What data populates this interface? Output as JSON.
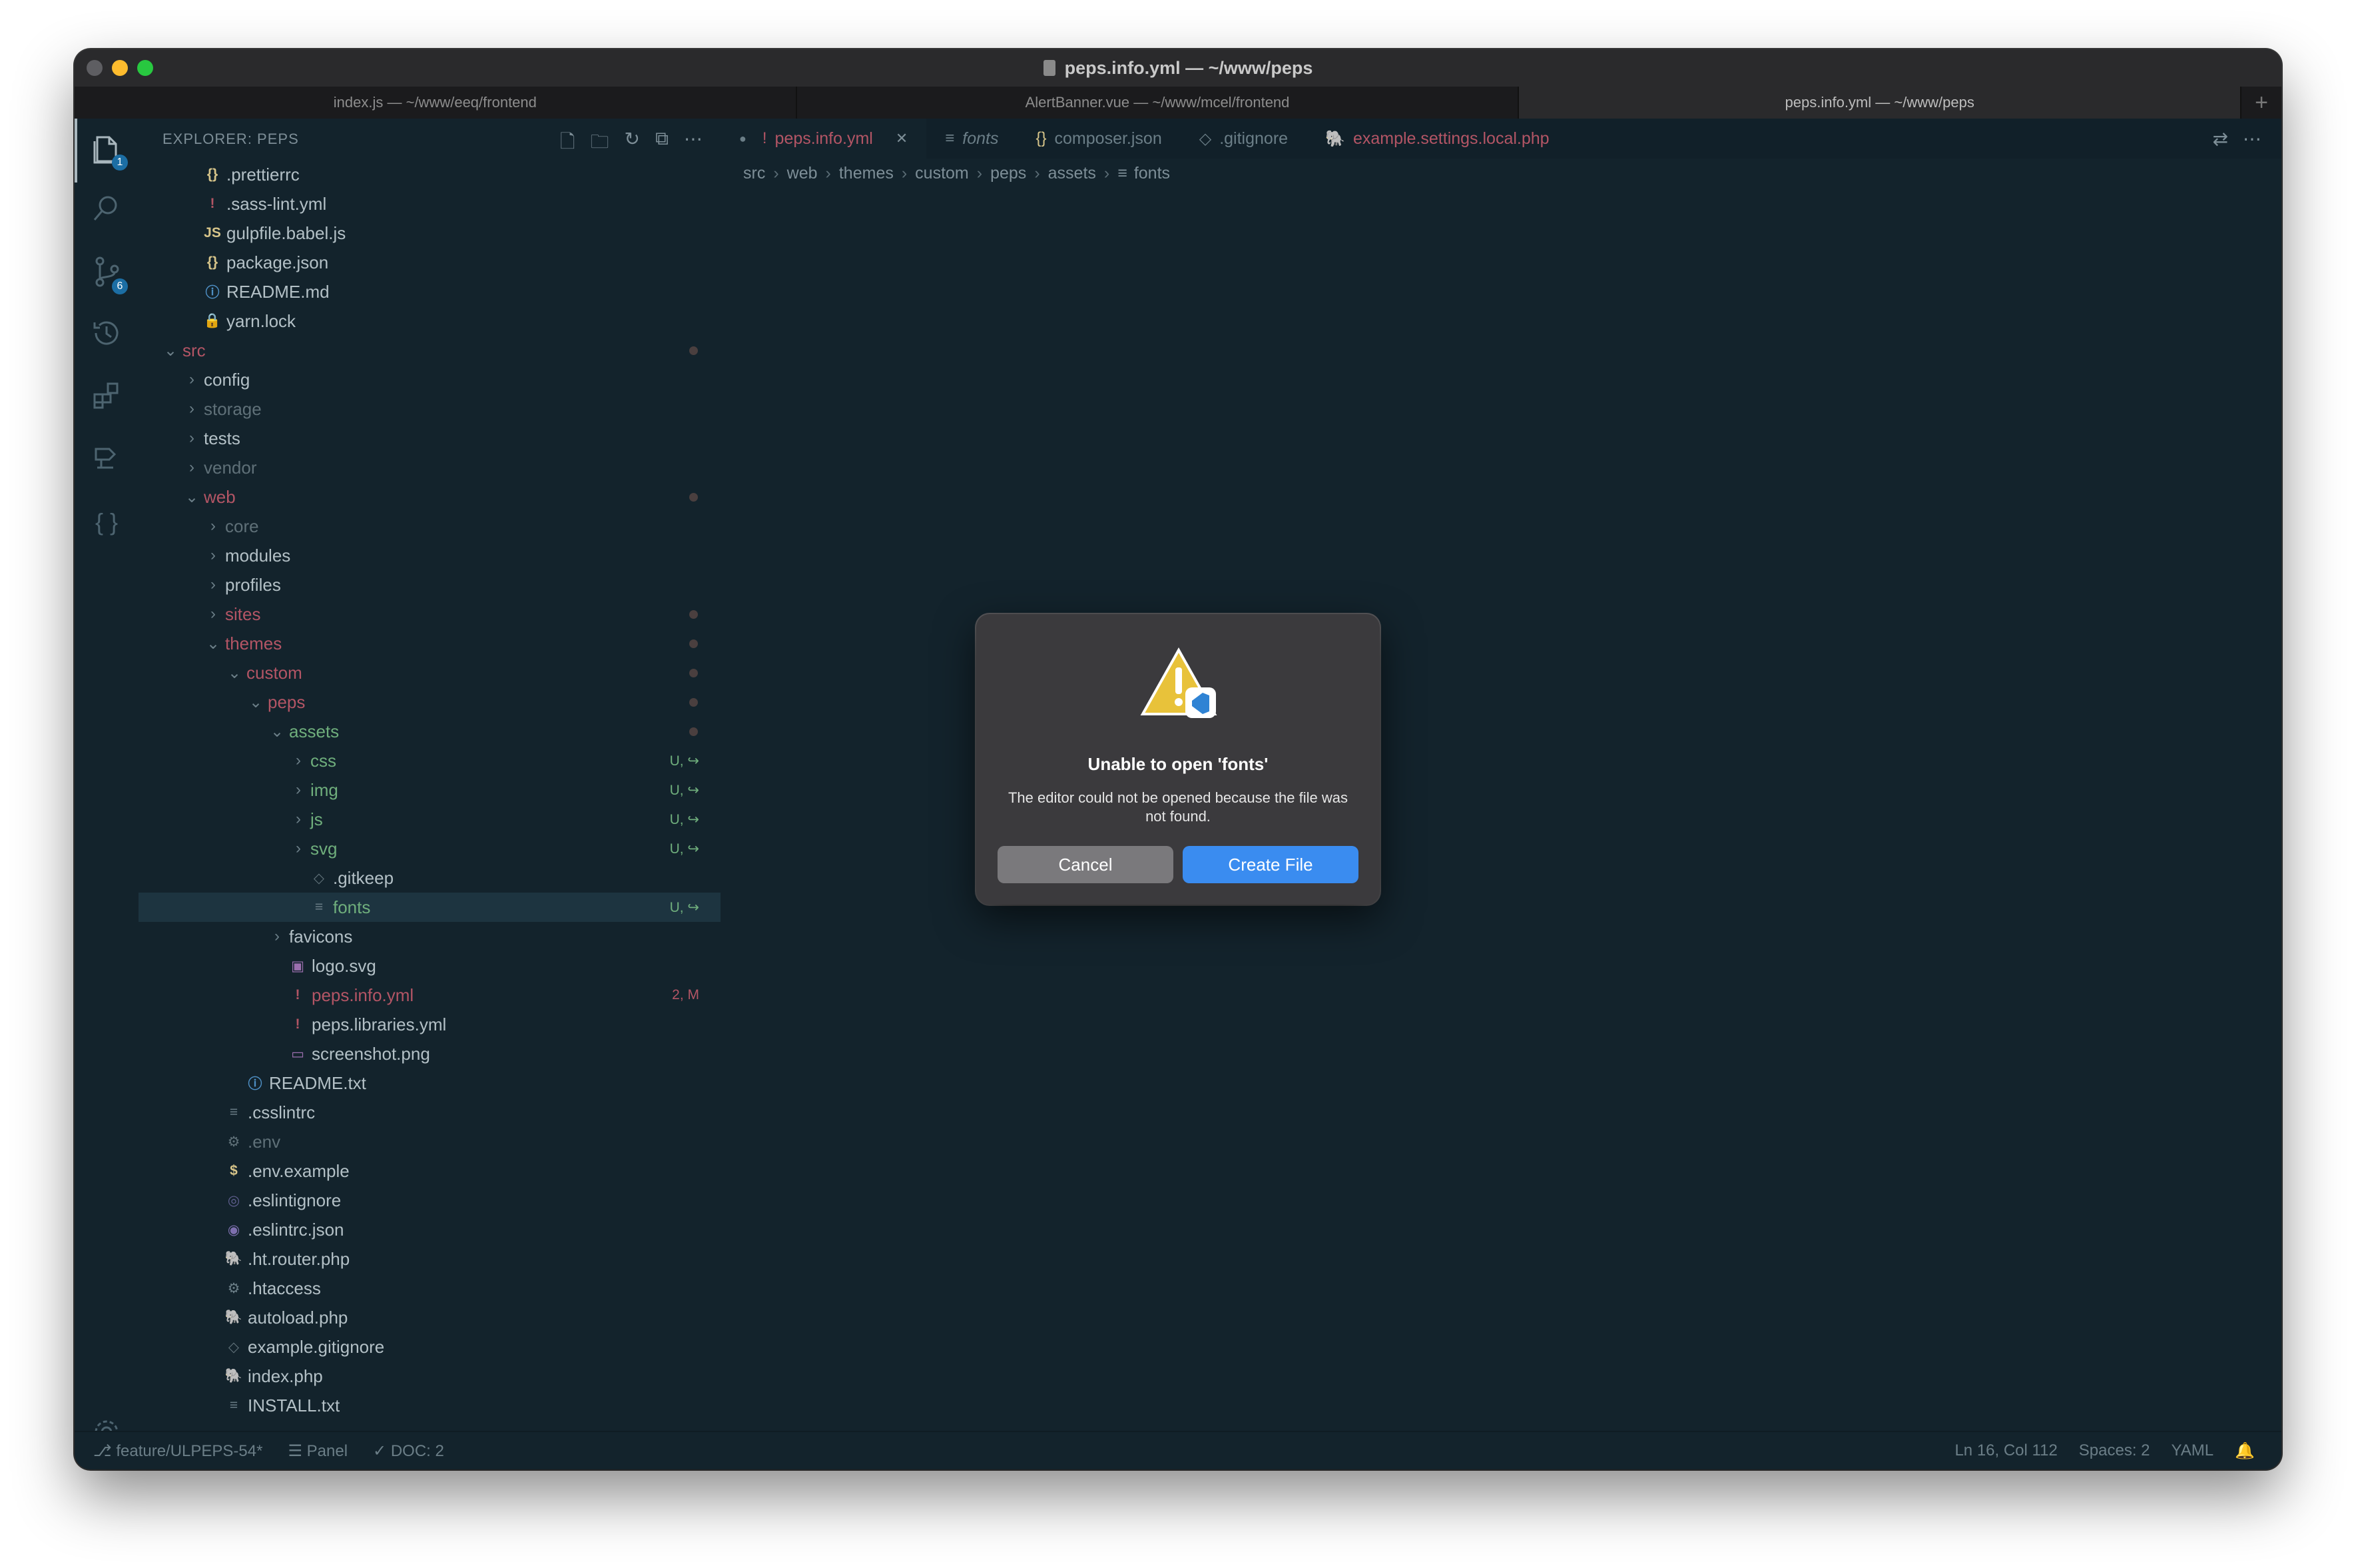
{
  "window": {
    "title": "peps.info.yml — ~/www/peps",
    "tabs": [
      "index.js — ~/www/eeq/frontend",
      "AlertBanner.vue — ~/www/mcel/frontend",
      "peps.info.yml — ~/www/peps"
    ],
    "add_tab": "+"
  },
  "activity_bar": {
    "explorer_badge": "1",
    "scm_badge": "6"
  },
  "sidebar": {
    "title": "EXPLORER: PEPS",
    "items": [
      {
        "label": ".prettierrc",
        "icon": "{}",
        "icon_color": "#d7c58a",
        "depth": 1,
        "chev": "",
        "color": "#b3c0c6",
        "deco": ""
      },
      {
        "label": ".sass-lint.yml",
        "icon": "!",
        "icon_color": "#b35565",
        "depth": 1,
        "chev": "",
        "color": "#b3c0c6",
        "deco": ""
      },
      {
        "label": "gulpfile.babel.js",
        "icon": "JS",
        "icon_color": "#d7c58a",
        "depth": 1,
        "chev": "",
        "color": "#b3c0c6",
        "deco": ""
      },
      {
        "label": "package.json",
        "icon": "{}",
        "icon_color": "#d7c58a",
        "depth": 1,
        "chev": "",
        "color": "#b3c0c6",
        "deco": ""
      },
      {
        "label": "README.md",
        "icon": "ⓘ",
        "icon_color": "#4e8fc4",
        "depth": 1,
        "chev": "",
        "color": "#b3c0c6",
        "deco": ""
      },
      {
        "label": "yarn.lock",
        "icon": "🔒",
        "icon_color": "#6b7e87",
        "depth": 1,
        "chev": "",
        "color": "#b3c0c6",
        "deco": ""
      },
      {
        "label": "src",
        "icon": "",
        "icon_color": "",
        "depth": 0,
        "chev": "⌄",
        "color": "#b35565",
        "deco": "dot"
      },
      {
        "label": "config",
        "icon": "",
        "icon_color": "",
        "depth": 1,
        "chev": "›",
        "color": "#b3c0c6",
        "deco": ""
      },
      {
        "label": "storage",
        "icon": "",
        "icon_color": "",
        "depth": 1,
        "chev": "›",
        "color": "#5f7078",
        "deco": ""
      },
      {
        "label": "tests",
        "icon": "",
        "icon_color": "",
        "depth": 1,
        "chev": "›",
        "color": "#b3c0c6",
        "deco": ""
      },
      {
        "label": "vendor",
        "icon": "",
        "icon_color": "",
        "depth": 1,
        "chev": "›",
        "color": "#5f7078",
        "deco": ""
      },
      {
        "label": "web",
        "icon": "",
        "icon_color": "",
        "depth": 1,
        "chev": "⌄",
        "color": "#b35565",
        "deco": "dot"
      },
      {
        "label": "core",
        "icon": "",
        "icon_color": "",
        "depth": 2,
        "chev": "›",
        "color": "#5f7078",
        "deco": ""
      },
      {
        "label": "modules",
        "icon": "",
        "icon_color": "",
        "depth": 2,
        "chev": "›",
        "color": "#b3c0c6",
        "deco": ""
      },
      {
        "label": "profiles",
        "icon": "",
        "icon_color": "",
        "depth": 2,
        "chev": "›",
        "color": "#b3c0c6",
        "deco": ""
      },
      {
        "label": "sites",
        "icon": "",
        "icon_color": "",
        "depth": 2,
        "chev": "›",
        "color": "#b35565",
        "deco": "dot"
      },
      {
        "label": "themes",
        "icon": "",
        "icon_color": "",
        "depth": 2,
        "chev": "⌄",
        "color": "#b35565",
        "deco": "dot"
      },
      {
        "label": "custom",
        "icon": "",
        "icon_color": "",
        "depth": 3,
        "chev": "⌄",
        "color": "#b35565",
        "deco": "dot"
      },
      {
        "label": "peps",
        "icon": "",
        "icon_color": "",
        "depth": 4,
        "chev": "⌄",
        "color": "#b35565",
        "deco": "dot"
      },
      {
        "label": "assets",
        "icon": "",
        "icon_color": "",
        "depth": 5,
        "chev": "⌄",
        "color": "#6fae7c",
        "deco": "dot"
      },
      {
        "label": "css",
        "icon": "",
        "icon_color": "",
        "depth": 6,
        "chev": "›",
        "color": "#6fae7c",
        "deco": "U, ↪"
      },
      {
        "label": "img",
        "icon": "",
        "icon_color": "",
        "depth": 6,
        "chev": "›",
        "color": "#6fae7c",
        "deco": "U, ↪"
      },
      {
        "label": "js",
        "icon": "",
        "icon_color": "",
        "depth": 6,
        "chev": "›",
        "color": "#6fae7c",
        "deco": "U, ↪"
      },
      {
        "label": "svg",
        "icon": "",
        "icon_color": "",
        "depth": 6,
        "chev": "›",
        "color": "#6fae7c",
        "deco": "U, ↪"
      },
      {
        "label": ".gitkeep",
        "icon": "◇",
        "icon_color": "#5f7078",
        "depth": 6,
        "chev": "",
        "color": "#b3c0c6",
        "deco": ""
      },
      {
        "label": "fonts",
        "icon": "≡",
        "icon_color": "#6b7e87",
        "depth": 6,
        "chev": "",
        "color": "#6fae7c",
        "deco": "U, ↪",
        "selected": true
      },
      {
        "label": "favicons",
        "icon": "",
        "icon_color": "",
        "depth": 5,
        "chev": "›",
        "color": "#b3c0c6",
        "deco": ""
      },
      {
        "label": "logo.svg",
        "icon": "▣",
        "icon_color": "#9b6fae",
        "depth": 5,
        "chev": "",
        "color": "#b3c0c6",
        "deco": ""
      },
      {
        "label": "peps.info.yml",
        "icon": "!",
        "icon_color": "#b35565",
        "depth": 5,
        "chev": "",
        "color": "#b35565",
        "deco": "2, M"
      },
      {
        "label": "peps.libraries.yml",
        "icon": "!",
        "icon_color": "#b35565",
        "depth": 5,
        "chev": "",
        "color": "#b3c0c6",
        "deco": ""
      },
      {
        "label": "screenshot.png",
        "icon": "▭",
        "icon_color": "#9b6fae",
        "depth": 5,
        "chev": "",
        "color": "#b3c0c6",
        "deco": ""
      },
      {
        "label": "README.txt",
        "icon": "ⓘ",
        "icon_color": "#4e8fc4",
        "depth": 3,
        "chev": "",
        "color": "#b3c0c6",
        "deco": ""
      },
      {
        "label": ".csslintrc",
        "icon": "≡",
        "icon_color": "#6b7e87",
        "depth": 2,
        "chev": "",
        "color": "#b3c0c6",
        "deco": ""
      },
      {
        "label": ".env",
        "icon": "⚙",
        "icon_color": "#5f7078",
        "depth": 2,
        "chev": "",
        "color": "#5f7078",
        "deco": ""
      },
      {
        "label": ".env.example",
        "icon": "$",
        "icon_color": "#d7c58a",
        "depth": 2,
        "chev": "",
        "color": "#b3c0c6",
        "deco": ""
      },
      {
        "label": ".eslintignore",
        "icon": "◎",
        "icon_color": "#5f5f8f",
        "depth": 2,
        "chev": "",
        "color": "#b3c0c6",
        "deco": ""
      },
      {
        "label": ".eslintrc.json",
        "icon": "◉",
        "icon_color": "#7d6fae",
        "depth": 2,
        "chev": "",
        "color": "#b3c0c6",
        "deco": ""
      },
      {
        "label": ".ht.router.php",
        "icon": "🐘",
        "icon_color": "#9b6fae",
        "depth": 2,
        "chev": "",
        "color": "#b3c0c6",
        "deco": ""
      },
      {
        "label": ".htaccess",
        "icon": "⚙",
        "icon_color": "#6b7e87",
        "depth": 2,
        "chev": "",
        "color": "#b3c0c6",
        "deco": ""
      },
      {
        "label": "autoload.php",
        "icon": "🐘",
        "icon_color": "#9b6fae",
        "depth": 2,
        "chev": "",
        "color": "#b3c0c6",
        "deco": ""
      },
      {
        "label": "example.gitignore",
        "icon": "◇",
        "icon_color": "#5f7078",
        "depth": 2,
        "chev": "",
        "color": "#b3c0c6",
        "deco": ""
      },
      {
        "label": "index.php",
        "icon": "🐘",
        "icon_color": "#9b6fae",
        "depth": 2,
        "chev": "",
        "color": "#b3c0c6",
        "deco": ""
      },
      {
        "label": "INSTALL.txt",
        "icon": "≡",
        "icon_color": "#6b7e87",
        "depth": 2,
        "chev": "",
        "color": "#b3c0c6",
        "deco": ""
      }
    ]
  },
  "editor": {
    "tabs": [
      {
        "label": "peps.info.yml",
        "icon": "!",
        "dirty": true,
        "active": true
      },
      {
        "label": "fonts",
        "icon": "≡",
        "italic": true
      },
      {
        "label": "composer.json",
        "icon": "{}"
      },
      {
        "label": ".gitignore",
        "icon": "◇"
      },
      {
        "label": "example.settings.local.php",
        "icon": "🐘"
      }
    ],
    "breadcrumb": [
      "src",
      "web",
      "themes",
      "custom",
      "peps",
      "assets",
      "fonts"
    ]
  },
  "dialog": {
    "title": "Unable to open 'fonts'",
    "message": "The editor could not be opened because the file was not found.",
    "cancel": "Cancel",
    "create": "Create File"
  },
  "statusbar": {
    "branch": "feature/ULPEPS-54*",
    "panel": "Panel",
    "doc": "DOC: 2",
    "position": "Ln 16, Col 112",
    "spaces": "Spaces: 2",
    "language": "YAML"
  }
}
